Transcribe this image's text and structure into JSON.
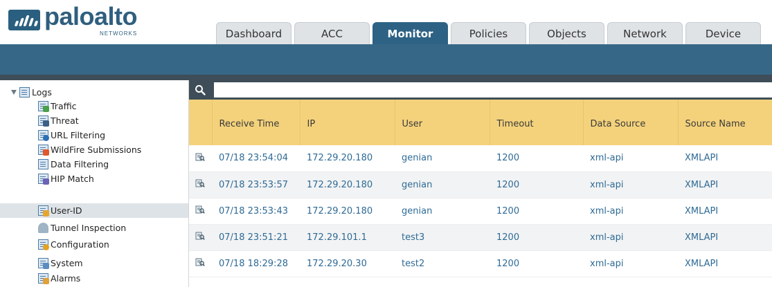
{
  "brand": {
    "name": "paloalto",
    "subtitle": "NETWORKS"
  },
  "tabs": [
    {
      "label": "Dashboard",
      "active": false
    },
    {
      "label": "ACC",
      "active": false
    },
    {
      "label": "Monitor",
      "active": true
    },
    {
      "label": "Policies",
      "active": false
    },
    {
      "label": "Objects",
      "active": false
    },
    {
      "label": "Network",
      "active": false
    },
    {
      "label": "Device",
      "active": false
    }
  ],
  "sidebar": {
    "root": {
      "label": "Logs",
      "icon": "logs-folder-icon"
    },
    "items": [
      {
        "label": "Traffic",
        "icon": "traffic-log-icon"
      },
      {
        "label": "Threat",
        "icon": "threat-log-icon"
      },
      {
        "label": "URL Filtering",
        "icon": "url-filtering-icon"
      },
      {
        "label": "WildFire Submissions",
        "icon": "wildfire-icon"
      },
      {
        "label": "Data Filtering",
        "icon": "data-filtering-icon"
      },
      {
        "label": "HIP Match",
        "icon": "hip-match-icon"
      },
      {
        "label": "User-ID",
        "icon": "user-id-icon",
        "selected": true
      },
      {
        "label": "Tunnel Inspection",
        "icon": "tunnel-inspection-icon"
      },
      {
        "label": "Configuration",
        "icon": "configuration-icon"
      },
      {
        "label": "System",
        "icon": "system-icon"
      },
      {
        "label": "Alarms",
        "icon": "alarms-icon"
      }
    ]
  },
  "search": {
    "value": "",
    "icon": "search-icon"
  },
  "table": {
    "columns": [
      "Receive Time",
      "IP",
      "User",
      "Timeout",
      "Data Source",
      "Source Name"
    ],
    "rows": [
      [
        "07/18 23:54:04",
        "172.29.20.180",
        "genian",
        "1200",
        "xml-api",
        "XMLAPI"
      ],
      [
        "07/18 23:53:57",
        "172.29.20.180",
        "genian",
        "1200",
        "xml-api",
        "XMLAPI"
      ],
      [
        "07/18 23:53:43",
        "172.29.20.180",
        "genian",
        "1200",
        "xml-api",
        "XMLAPI"
      ],
      [
        "07/18 23:51:21",
        "172.29.101.1",
        "test3",
        "1200",
        "xml-api",
        "XMLAPI"
      ],
      [
        "07/18 18:29:28",
        "172.29.20.30",
        "test2",
        "1200",
        "xml-api",
        "XMLAPI"
      ]
    ],
    "row_icon": "detail-view-icon"
  },
  "colors": {
    "brand": "#2f5f7e",
    "active_tab": "#2d6284",
    "nav_bar": "#376786",
    "header_row": "#f4d27b",
    "link_text": "#2e6a95"
  }
}
